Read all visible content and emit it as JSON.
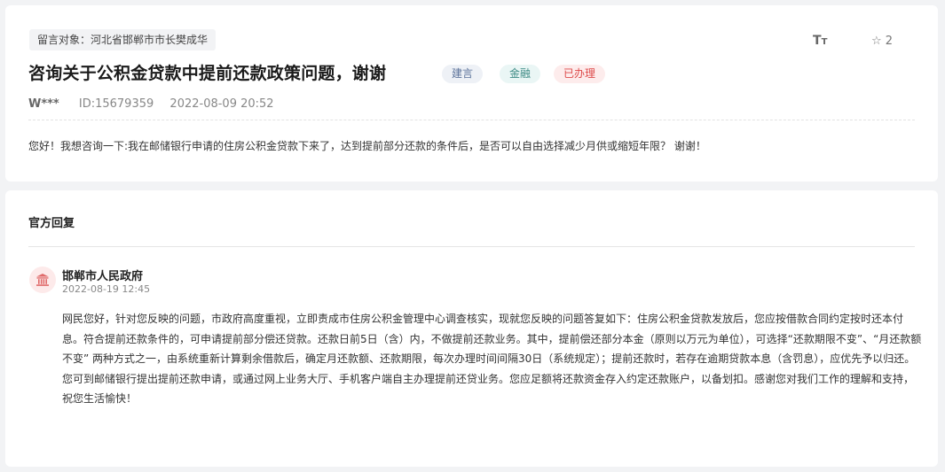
{
  "question": {
    "target_label": "留言对象：",
    "target_value": "河北省邯郸市市长樊成华",
    "title": "咨询关于公积金贷款中提前还款政策问题，谢谢",
    "tags": [
      {
        "label": "建言",
        "color": "#5a7199"
      },
      {
        "label": "金融",
        "color": "#3d8a84"
      },
      {
        "label": "已办理",
        "color": "#dd4a4a"
      }
    ],
    "font_toggle_big": "T",
    "font_toggle_small": "T",
    "favorite_count": "2",
    "user": "W***",
    "id": "ID:15679359",
    "datetime": "2022-08-09 20:52",
    "content": "您好！我想咨询一下:我在邮储银行申请的住房公积金贷款下来了，达到提前部分还款的条件后，是否可以自由选择减少月供或缩短年限？ 谢谢！"
  },
  "reply": {
    "heading": "官方回复",
    "org": "邯郸市人民政府",
    "time": "2022-08-19 12:45",
    "content": "网民您好，针对您反映的问题，市政府高度重视，立即责成市住房公积金管理中心调查核实，现就您反映的问题答复如下：住房公积金贷款发放后，您应按借款合同约定按时还本付息。符合提前还款条件的，可申请提前部分偿还贷款。还款日前5日（含）内，不做提前还款业务。其中，提前偿还部分本金（原则以万元为单位），可选择“还款期限不变”、“月还款额不变” 两种方式之一，由系统重新计算剩余借款后，确定月还款额、还款期限，每次办理时间间隔30日（系统规定）；提前还款时，若存在逾期贷款本息（含罚息），应优先予以归还。您可到邮储银行提出提前还款申请，或通过网上业务大厅、手机客户端自主办理提前还贷业务。您应足额将还款资金存入约定还款账户，以备划扣。感谢您对我们工作的理解和支持，祝您生活愉快！"
  },
  "icons": {
    "font_size": "font-size-icon",
    "favorite": "star-outline-icon",
    "avatar": "government-building-icon"
  },
  "colors": {
    "page_bg": "#f2f3f5",
    "done_tag": "#dd4a4a",
    "avatar_bg": "#fdeaea"
  }
}
